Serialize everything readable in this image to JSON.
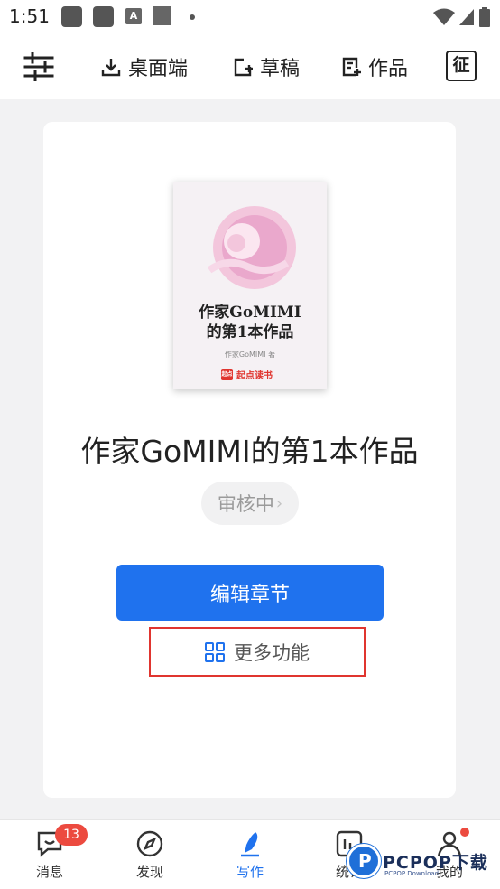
{
  "status_bar": {
    "time": "1:51",
    "notif_letter": "A"
  },
  "toolbar": {
    "settings_icon": "sliders-icon",
    "desktop_label": "桌面端",
    "draft_label": "草稿",
    "works_label": "作品",
    "zheng_label": "征"
  },
  "book": {
    "cover_title_line1": "作家GoMIMI",
    "cover_title_line2": "的第1本作品",
    "cover_author": "作家GoMIMI 著",
    "cover_brand_logo": "起点",
    "cover_brand": "起点读书",
    "title": "作家GoMIMI的第1本作品",
    "status": "审核中",
    "status_arrow": "›"
  },
  "actions": {
    "edit_label": "编辑章节",
    "more_label": "更多功能"
  },
  "bottom_nav": {
    "items": [
      {
        "label": "消息",
        "badge": "13"
      },
      {
        "label": "发现"
      },
      {
        "label": "写作"
      },
      {
        "label": "统计"
      },
      {
        "label": "我的"
      }
    ]
  },
  "watermark": {
    "text": "PCPOP下载",
    "sub": "PCPOP Download"
  },
  "colors": {
    "accent": "#1f72ee",
    "highlight": "#e0352f",
    "badge": "#ec4a3f"
  }
}
